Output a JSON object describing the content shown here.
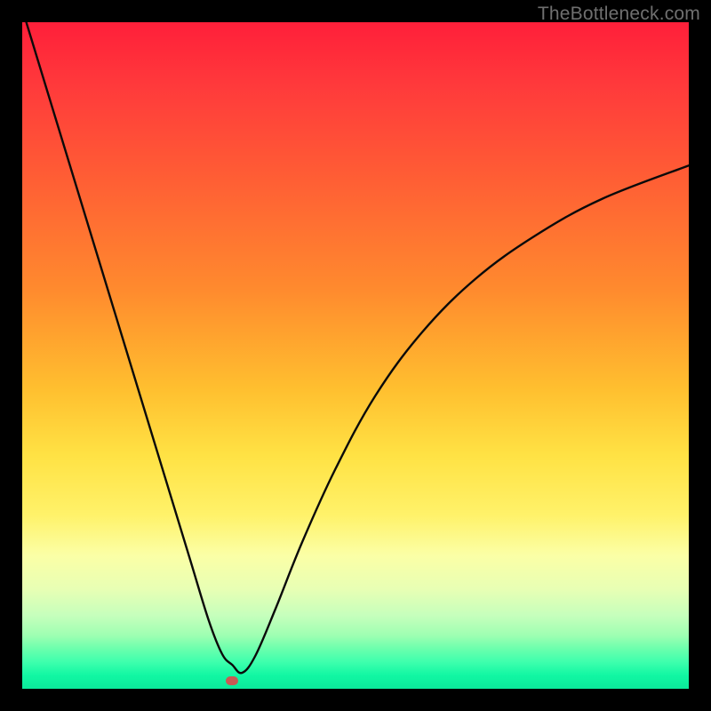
{
  "watermark": "TheBottleneck.com",
  "colors": {
    "curve_stroke": "#0a0a0a",
    "page_bg": "#000000",
    "redspot": "#c85a54"
  },
  "chart_data": {
    "type": "line",
    "title": "",
    "xlabel": "",
    "ylabel": "",
    "xlim": [
      0,
      100
    ],
    "ylim": [
      0,
      100
    ],
    "grid": false,
    "series": [
      {
        "name": "bottleneck-curve",
        "x": [
          0,
          5,
          10,
          15,
          20,
          25,
          28,
          30,
          31.5,
          33,
          35,
          38,
          42,
          47,
          53,
          60,
          68,
          77,
          87,
          100
        ],
        "y": [
          102,
          85.6,
          69.2,
          52.8,
          36.4,
          20,
          10.2,
          5.2,
          3.6,
          2.4,
          5,
          12,
          22,
          33,
          44,
          53.5,
          61.5,
          68,
          73.5,
          78.5
        ]
      }
    ],
    "marker": {
      "name": "highlight-point",
      "x": 31.5,
      "y": 1.2
    }
  }
}
